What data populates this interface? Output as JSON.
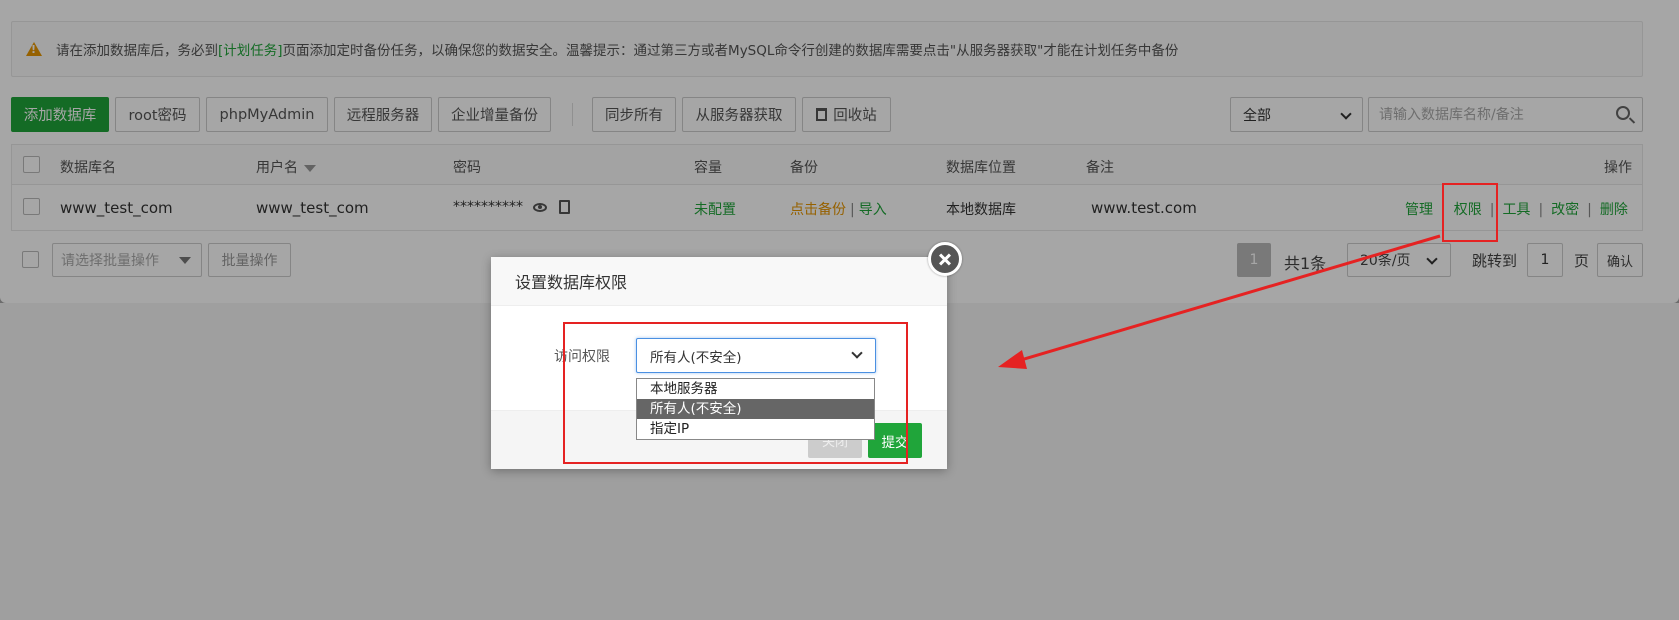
{
  "notice": {
    "text_before": "请在添加数据库后，务必到",
    "link": "[计划任务]",
    "text_after": "页面添加定时备份任务，以确保您的数据安全。温馨提示：通过第三方或者MySQL命令行创建的数据库需要点击\"从服务器获取\"才能在计划任务中备份"
  },
  "toolbar": {
    "add_db": "添加数据库",
    "root_pwd": "root密码",
    "phpmyadmin": "phpMyAdmin",
    "remote": "远程服务器",
    "enterprise": "企业增量备份",
    "sync_all": "同步所有",
    "fetch": "从服务器获取",
    "recycle": "回收站",
    "filter_value": "全部",
    "search_placeholder": "请输入数据库名称/备注"
  },
  "table": {
    "headers": {
      "name": "数据库名",
      "user": "用户名",
      "password": "密码",
      "capacity": "容量",
      "backup": "备份",
      "location": "数据库位置",
      "note": "备注",
      "ops": "操作"
    },
    "row": {
      "name": "www_test_com",
      "user": "www_test_com",
      "password": "**********",
      "capacity": "未配置",
      "backup_click": "点击备份",
      "backup_sep": "|",
      "import": "导入",
      "location": "本地数据库",
      "note": "www.test.com",
      "ops": {
        "manage": "管理",
        "perm": "权限",
        "tools": "工具",
        "chpwd": "改密",
        "delete": "删除",
        "sep": "|"
      }
    }
  },
  "footer": {
    "batch_placeholder": "请选择批量操作",
    "batch_btn": "批量操作",
    "current_page": "1",
    "total": "共1条",
    "page_size": "20条/页",
    "jump": "跳转到",
    "jump_value": "1",
    "page_unit": "页",
    "confirm": "确认"
  },
  "dialog": {
    "title": "设置数据库权限",
    "label": "访问权限",
    "selected": "所有人(不安全)",
    "options": [
      "本地服务器",
      "所有人(不安全)",
      "指定IP"
    ],
    "close": "关闭",
    "submit": "提交"
  },
  "colors": {
    "brand_green": "#20a53a",
    "warning_orange": "#e69500",
    "annotation_red": "#e52222"
  }
}
